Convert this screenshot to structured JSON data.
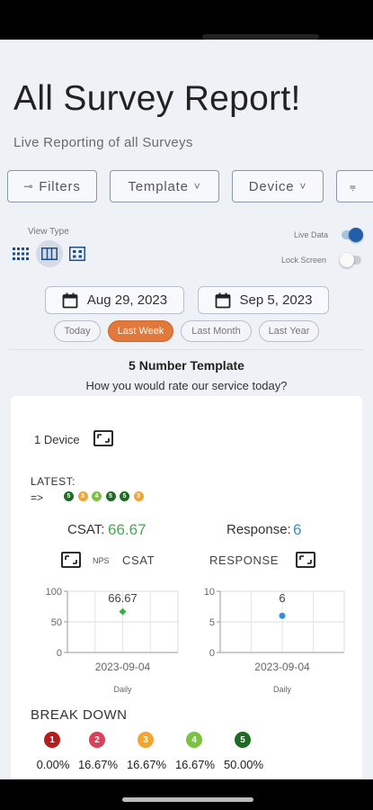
{
  "header": {
    "title": "All Survey Report!",
    "subtitle": "Live Reporting of all Surveys"
  },
  "filters": {
    "filters_label": "Filters",
    "template_label": "Template",
    "device_label": "Device"
  },
  "view": {
    "view_type_label": "View Type",
    "live_data_label": "Live Data",
    "live_data_on": true,
    "lock_screen_label": "Lock Screen",
    "lock_screen_on": false
  },
  "dates": {
    "start": "Aug 29, 2023",
    "end": "Sep 5, 2023"
  },
  "ranges": [
    {
      "label": "Today",
      "active": false
    },
    {
      "label": "Last Week",
      "active": true
    },
    {
      "label": "Last Month",
      "active": false
    },
    {
      "label": "Last Year",
      "active": false
    }
  ],
  "template": {
    "name": "5 Number Template",
    "question": "How you would rate our service today?"
  },
  "card": {
    "device_count": "1 Device",
    "latest_label": "LATEST:",
    "latest_arrow": "=>",
    "latest_scores": [
      "5",
      "3",
      "4",
      "5",
      "5",
      "3"
    ],
    "csat_label": "CSAT:",
    "csat_value": "66.67",
    "response_label": "Response:",
    "response_value": "6",
    "nps_label": "NPS",
    "csat_tab": "CSAT",
    "response_tab": "RESPONSE",
    "breakdown_label": "BREAK DOWN",
    "breakdown": [
      {
        "score": "1",
        "pct": "0.00%"
      },
      {
        "score": "2",
        "pct": "16.67%"
      },
      {
        "score": "3",
        "pct": "16.67%"
      },
      {
        "score": "4",
        "pct": "16.67%"
      },
      {
        "score": "5",
        "pct": "50.00%"
      }
    ]
  },
  "colors": {
    "score_1": "#b71c1c",
    "score_2": "#d9415a",
    "score_3": "#f2a531",
    "score_4": "#7cc242",
    "score_5": "#1e6b23",
    "csat_green": "#3fae49",
    "response_blue": "#2f8fe0",
    "accent_orange": "#e0793b",
    "toggle_blue": "#1f5fa8"
  },
  "chart_data": [
    {
      "type": "scatter",
      "x": [
        "2023-09-04"
      ],
      "y": [
        66.67
      ],
      "data_labels": [
        "66.67"
      ],
      "xlabel": "Daily",
      "yticks": [
        "100",
        "50",
        "0"
      ],
      "ylim": [
        0,
        100
      ],
      "marker": "diamond",
      "color": "#3fae49"
    },
    {
      "type": "scatter",
      "x": [
        "2023-09-04"
      ],
      "y": [
        6
      ],
      "data_labels": [
        "6"
      ],
      "xlabel": "Daily",
      "yticks": [
        "10",
        "5",
        "0"
      ],
      "ylim": [
        0,
        10
      ],
      "marker": "circle",
      "color": "#2f8fe0"
    }
  ]
}
